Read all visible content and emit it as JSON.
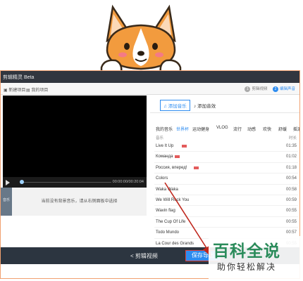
{
  "app": {
    "title": "剪辑精灵 Beta"
  },
  "toolbar": {
    "new_project": "新建项目",
    "my_projects": "我的项目"
  },
  "steps": [
    {
      "num": "1",
      "label": "剪辑视频"
    },
    {
      "num": "2",
      "label": "编辑声音"
    }
  ],
  "player": {
    "time": "00:00:00/00:20:04"
  },
  "music_track": {
    "label": "音乐",
    "empty_hint": "当前没有背景音乐，请从右侧面板中选择"
  },
  "panel": {
    "tabs": [
      {
        "label": "添加音乐"
      },
      {
        "label": "添加音效"
      }
    ],
    "categories": [
      "我的音乐",
      "世界杯",
      "运动健身",
      "VLOG",
      "流行",
      "动感",
      "欢快",
      "舒缓",
      "摇滚"
    ],
    "active_category": "世界杯",
    "header": {
      "name": "音乐",
      "duration": "时长"
    },
    "tracks": [
      {
        "name": "Live It Up",
        "flag": true,
        "duration": "01:35"
      },
      {
        "name": "Команда",
        "flag": true,
        "duration": "01:02"
      },
      {
        "name": "Россия, вперед!",
        "flag": true,
        "duration": "01:18"
      },
      {
        "name": "Colors",
        "flag": false,
        "duration": "00:54"
      },
      {
        "name": "Waka Waka",
        "flag": false,
        "duration": "00:58"
      },
      {
        "name": "We Will Rock You",
        "flag": false,
        "duration": "00:59"
      },
      {
        "name": "Wavin flag",
        "flag": false,
        "duration": "00:55"
      },
      {
        "name": "The Cup Of Life",
        "flag": false,
        "duration": "00:55"
      },
      {
        "name": "Todo Mundo",
        "flag": false,
        "duration": "00:57"
      },
      {
        "name": "La Cour des Grands",
        "flag": false,
        "duration": "00:55"
      }
    ]
  },
  "bottom": {
    "back": "< 剪辑视频",
    "save": "保存导出"
  },
  "watermark": {
    "title": "百科全说",
    "subtitle": "助你轻松解决"
  },
  "colors": {
    "accent": "#2d8cf0",
    "highlight": "#e0413a",
    "watermark": "#2a8b5a"
  }
}
